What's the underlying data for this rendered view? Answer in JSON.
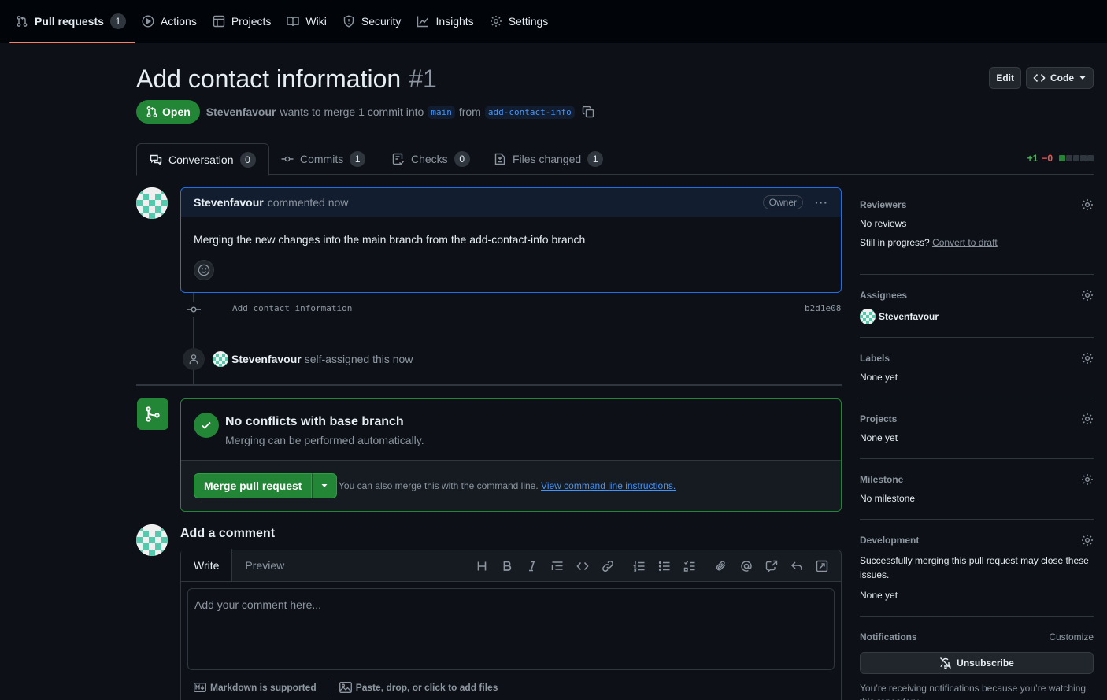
{
  "repo_nav": {
    "items": [
      {
        "label": "Pull requests",
        "count": "1",
        "icon": "git-pull-request-icon"
      },
      {
        "label": "Actions",
        "icon": "play-icon"
      },
      {
        "label": "Projects",
        "icon": "table-icon"
      },
      {
        "label": "Wiki",
        "icon": "book-icon"
      },
      {
        "label": "Security",
        "icon": "shield-icon"
      },
      {
        "label": "Insights",
        "icon": "graph-icon"
      },
      {
        "label": "Settings",
        "icon": "gear-icon"
      }
    ]
  },
  "header": {
    "title": "Add contact information",
    "number": "#1",
    "edit_label": "Edit",
    "code_label": "Code",
    "state": "Open",
    "author": "Stevenfavour",
    "merge_text_1": "wants to merge 1 commit into",
    "base_branch": "main",
    "merge_text_2": "from",
    "head_branch": "add-contact-info"
  },
  "pr_tabs": [
    {
      "label": "Conversation",
      "count": "0"
    },
    {
      "label": "Commits",
      "count": "1"
    },
    {
      "label": "Checks",
      "count": "0"
    },
    {
      "label": "Files changed",
      "count": "1"
    }
  ],
  "diffstat": {
    "additions": "+1",
    "deletions": "−0",
    "filled_blocks": 1,
    "total_blocks": 5
  },
  "comment": {
    "author": "Stevenfavour",
    "action": "commented now",
    "role": "Owner",
    "body": "Merging the new changes into the main branch from the add-contact-info branch"
  },
  "timeline": {
    "commit_message": "Add contact information",
    "commit_sha": "b2d1e08",
    "event_actor": "Stevenfavour",
    "event_text": "self-assigned this now"
  },
  "merge": {
    "title": "No conflicts with base branch",
    "subtitle": "Merging can be performed automatically.",
    "button_label": "Merge pull request",
    "note": "You can also merge this with the command line.",
    "note_link": "View command line instructions."
  },
  "add_comment": {
    "title": "Add a comment",
    "write_tab": "Write",
    "preview_tab": "Preview",
    "placeholder": "Add your comment here...",
    "markdown_note": "Markdown is supported",
    "attach_note": "Paste, drop, or click to add files"
  },
  "sidebar": {
    "reviewers": {
      "label": "Reviewers",
      "value": "No reviews",
      "progress_text": "Still in progress?",
      "draft_link": "Convert to draft"
    },
    "assignees": {
      "label": "Assignees",
      "value": "Stevenfavour"
    },
    "labels": {
      "label": "Labels",
      "value": "None yet"
    },
    "projects": {
      "label": "Projects",
      "value": "None yet"
    },
    "milestone": {
      "label": "Milestone",
      "value": "No milestone"
    },
    "development": {
      "label": "Development",
      "description": "Successfully merging this pull request may close these issues.",
      "value": "None yet"
    },
    "notifications": {
      "label": "Notifications",
      "customize": "Customize",
      "button": "Unsubscribe",
      "note": "You’re receiving notifications because you’re watching this repository."
    }
  },
  "colors": {
    "accent_green": "#238636",
    "link_blue": "#4493f8",
    "tab_underline": "#f78166",
    "background": "#0d1117"
  }
}
